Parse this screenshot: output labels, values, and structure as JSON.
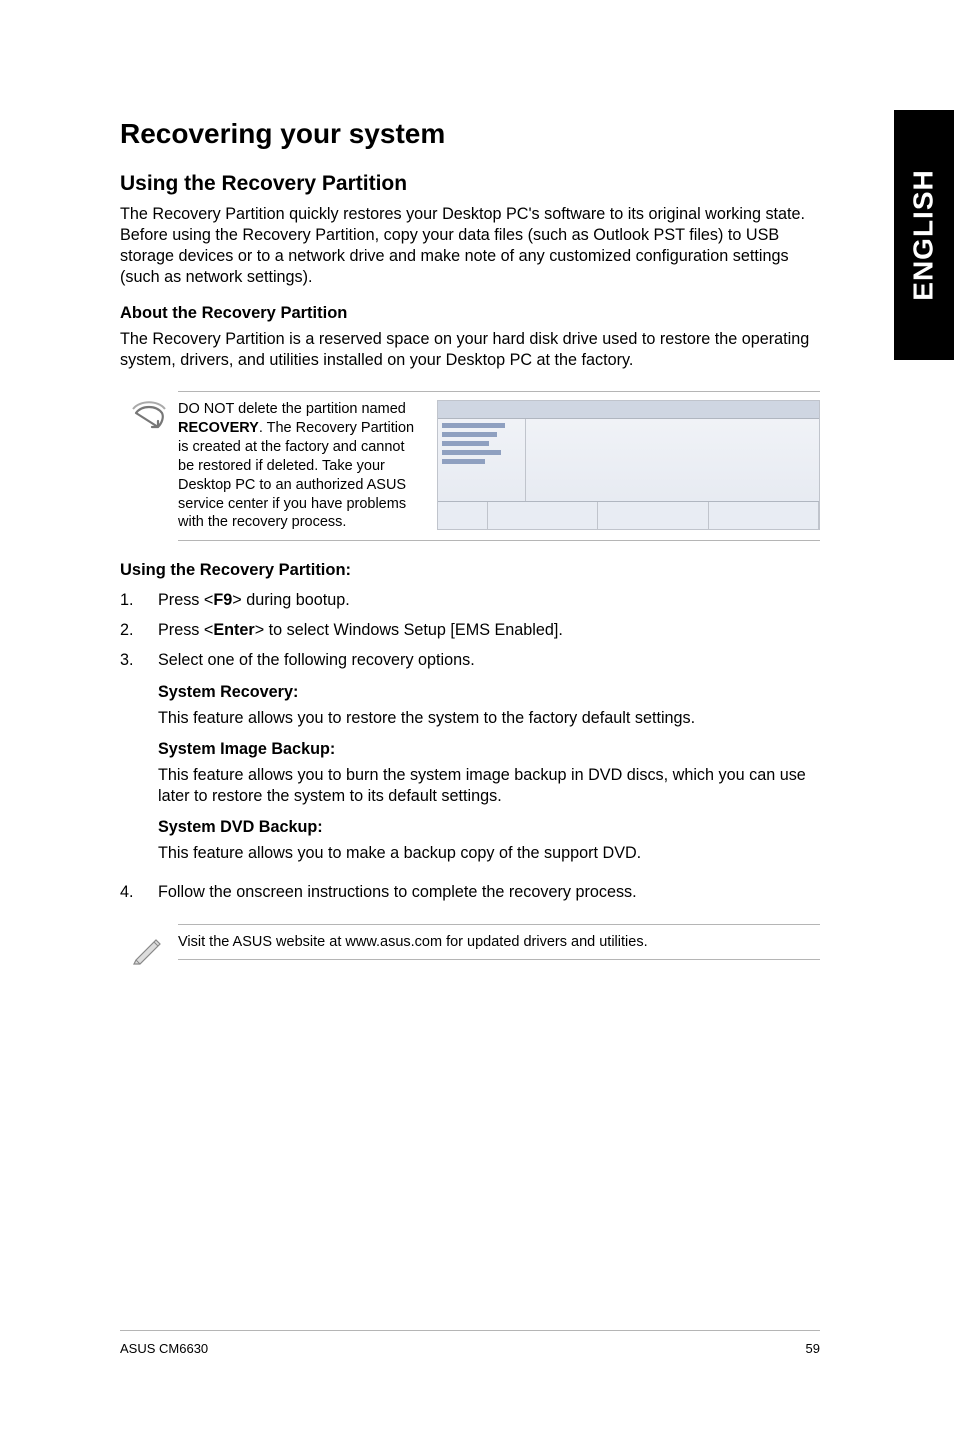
{
  "side_tab": "ENGLISH",
  "title": "Recovering your system",
  "section1": {
    "heading": "Using the Recovery Partition",
    "intro": "The Recovery Partition quickly restores your Desktop PC's software to its original working state. Before using the Recovery Partition, copy your data files (such as Outlook PST files) to USB storage devices or to a network drive and make note of any customized configuration settings (such as network settings).",
    "about_heading": "About the Recovery Partition",
    "about_para": "The Recovery Partition is a reserved space on your hard disk drive used to restore the operating system, drivers, and utilities installed on your Desktop PC at the factory."
  },
  "warning": {
    "pre": "DO NOT delete the partition named ",
    "bold": "RECOVERY",
    "post": ". The Recovery Partition is created at the factory and cannot be restored if deleted. Take your Desktop PC to an authorized ASUS service center if you have problems with the recovery process."
  },
  "using": {
    "heading": "Using the Recovery Partition:",
    "steps": [
      {
        "num": "1.",
        "pre": "Press <",
        "bold": "F9",
        "post": "> during bootup."
      },
      {
        "num": "2.",
        "pre": "Press <",
        "bold": "Enter",
        "post": "> to select Windows Setup [EMS Enabled]."
      },
      {
        "num": "3.",
        "text": "Select one of the following recovery options."
      }
    ],
    "options": [
      {
        "heading": "System Recovery:",
        "text": "This feature allows you to restore the system to the factory default settings."
      },
      {
        "heading": "System Image Backup:",
        "text": "This feature allows you to burn the system image backup in DVD discs, which you can use later to restore the system to its default settings."
      },
      {
        "heading": "System DVD Backup:",
        "text": "This feature allows you to make a backup copy of the support DVD."
      }
    ],
    "step4": {
      "num": "4.",
      "text": "Follow the onscreen instructions to complete the recovery process."
    }
  },
  "info_note": "Visit the ASUS website at www.asus.com for updated drivers and utilities.",
  "footer": {
    "left": "ASUS CM6630",
    "right": "59"
  }
}
